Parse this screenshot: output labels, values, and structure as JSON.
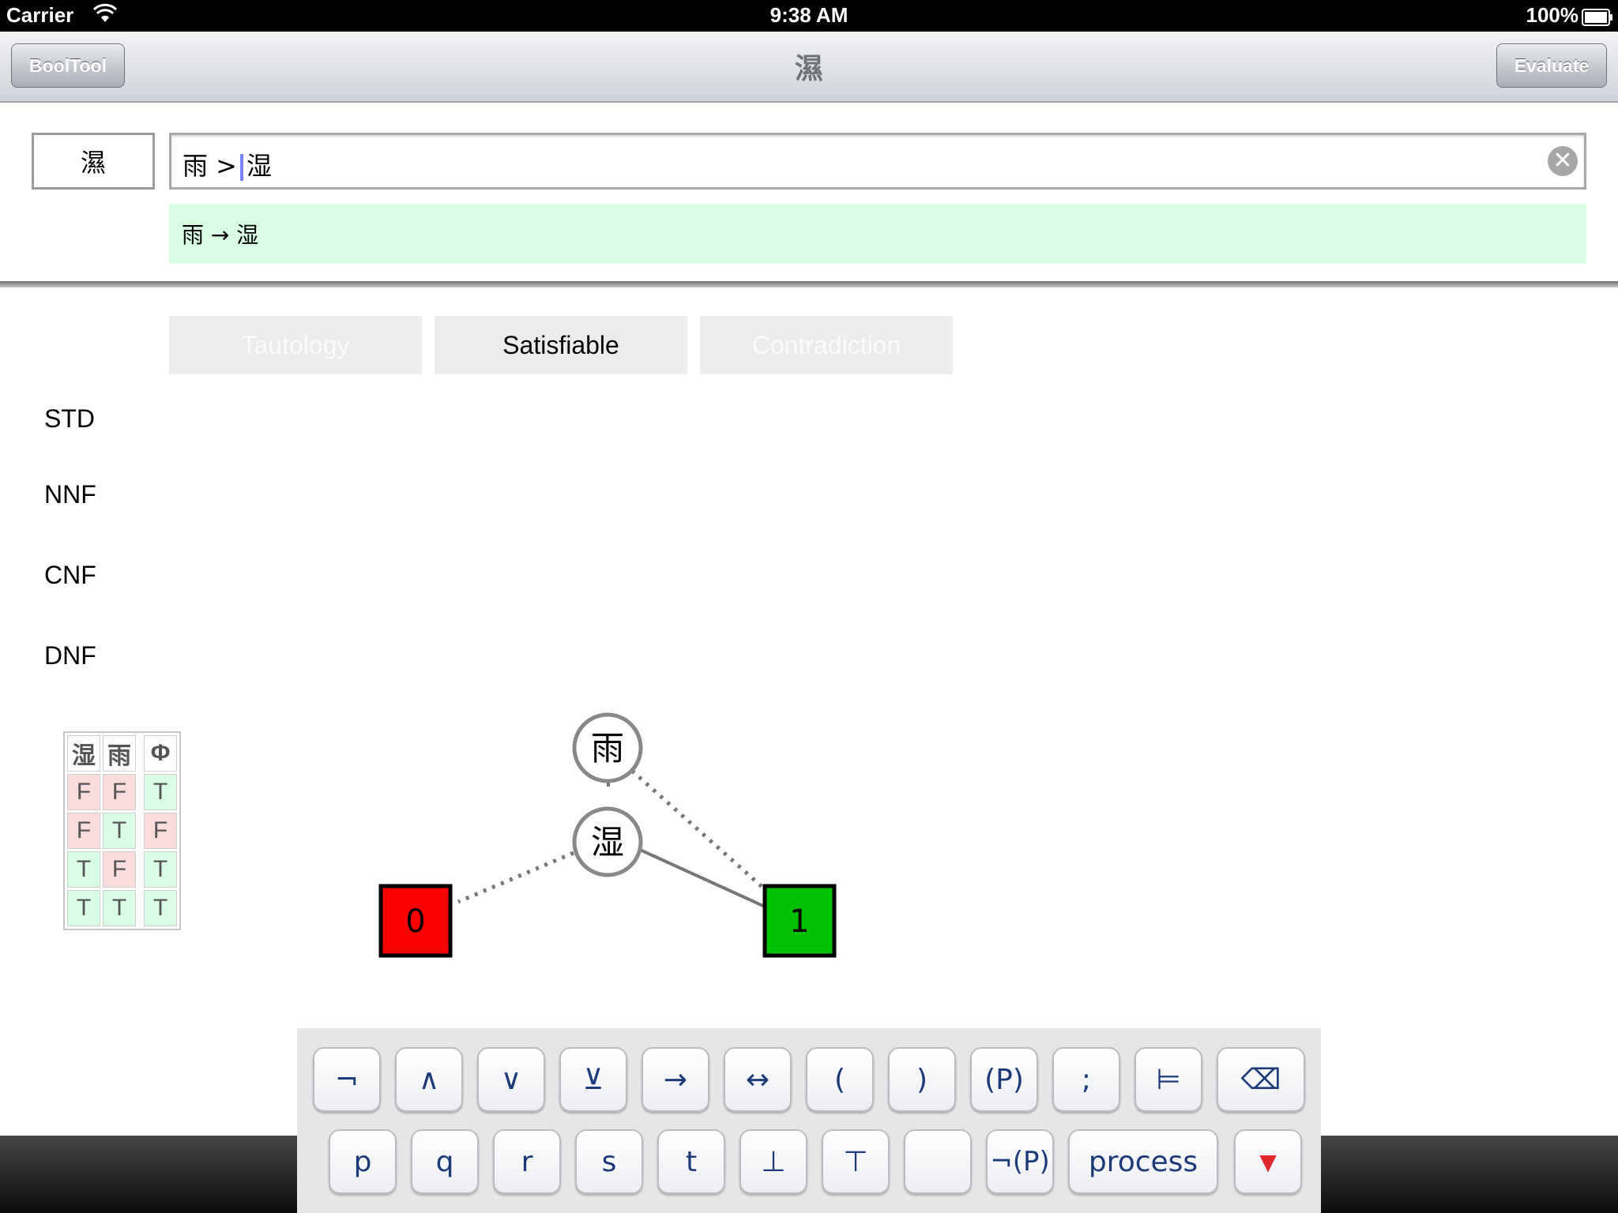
{
  "status_bar": {
    "carrier": "Carrier",
    "time": "9:38 AM",
    "battery": "100%",
    "wifi_icon": "wifi-icon",
    "battery_icon": "battery-icon"
  },
  "nav": {
    "back_label": "BoolTool",
    "title": "濕",
    "evaluate_label": "Evaluate"
  },
  "input": {
    "name": "濕",
    "formula_left": "雨 >",
    "formula_right": "湿",
    "parsed": "雨 → 湿",
    "clear_icon": "clear-icon"
  },
  "classification": {
    "tautology": "Tautology",
    "satisfiable": "Satisfiable",
    "contradiction": "Contradiction",
    "active": "Satisfiable"
  },
  "forms": {
    "std": "STD",
    "nnf": "NNF",
    "cnf": "CNF",
    "dnf": "DNF"
  },
  "truth_table": {
    "headers": [
      "湿",
      "雨",
      "Φ"
    ],
    "rows": [
      [
        "F",
        "F",
        "T"
      ],
      [
        "F",
        "T",
        "F"
      ],
      [
        "T",
        "F",
        "T"
      ],
      [
        "T",
        "T",
        "T"
      ]
    ]
  },
  "bdd": {
    "nodes": [
      {
        "label": "雨"
      },
      {
        "label": "湿"
      }
    ],
    "terminal_false": "0",
    "terminal_true": "1",
    "false_color": "#ff0000",
    "true_color": "#00c000"
  },
  "keyboard": {
    "row1": [
      "¬",
      "∧",
      "∨",
      "⊻",
      "→",
      "↔",
      "(",
      ")",
      "(P)",
      ";",
      "⊨",
      "⌫"
    ],
    "row2": [
      "p",
      "q",
      "r",
      "s",
      "t",
      "⊥",
      "⊤",
      "",
      "¬(P)",
      "process",
      "▼"
    ]
  }
}
